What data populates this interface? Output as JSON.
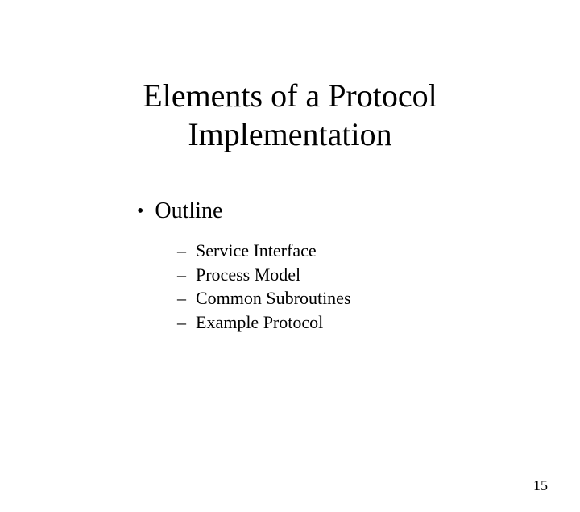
{
  "title_line1": "Elements of a Protocol",
  "title_line2": "Implementation",
  "outline": {
    "heading": "Outline",
    "bullet_symbol": "•",
    "dash_symbol": "–",
    "items": [
      "Service Interface",
      "Process Model",
      "Common Subroutines",
      "Example Protocol"
    ]
  },
  "page_number": "15"
}
